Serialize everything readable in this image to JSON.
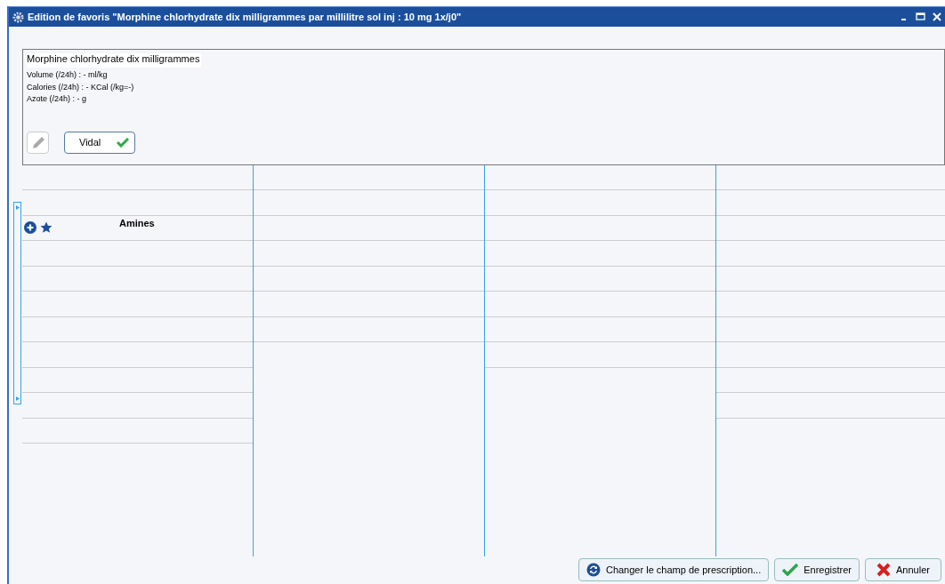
{
  "window": {
    "title": "Edition de favoris \"Morphine chlorhydrate dix milligrammes par millilitre sol inj : 10 mg 1x/j0\""
  },
  "info": {
    "drug_name": "Morphine chlorhydrate dix milligrammes",
    "lines": [
      "Volume (/24h) : - ml/kg",
      "Calories (/24h) : - KCal (/kg=-)",
      "Azote (/24h) : - g"
    ],
    "vidal_button": "Vidal",
    "vidal_ok": true
  },
  "groups": [
    {
      "label": "Amines"
    }
  ],
  "buttons": [
    {
      "kind": "change",
      "label": "Changer le champ de prescription..."
    },
    {
      "kind": "save",
      "label": "Enregistrer"
    },
    {
      "kind": "cancel",
      "label": "Annuler"
    }
  ]
}
